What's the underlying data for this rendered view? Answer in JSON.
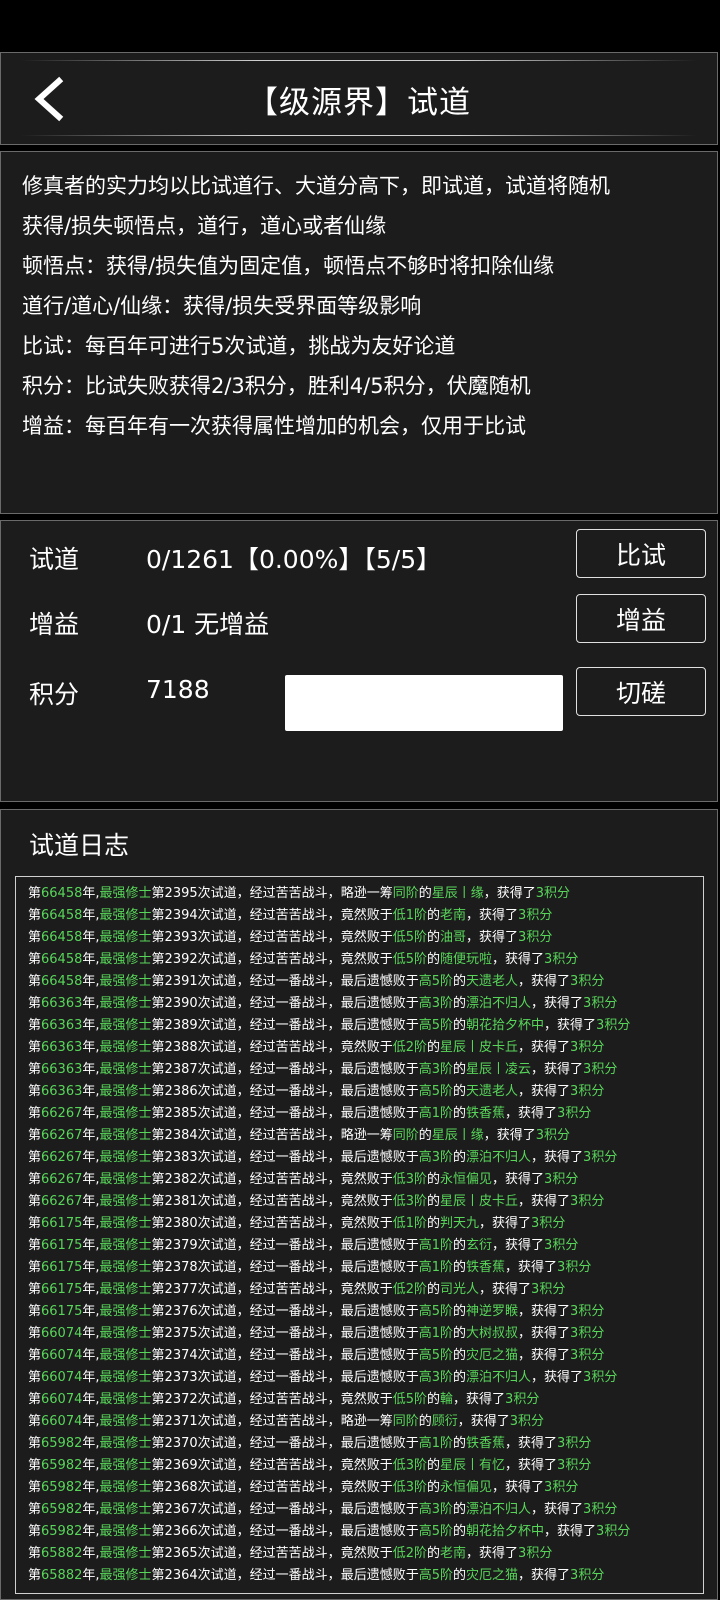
{
  "header": {
    "title": "【级源界】试道"
  },
  "rules": [
    "修真者的实力均以比试道行、大道分高下，即试道，试道将随机",
    "获得/损失顿悟点，道行，道心或者仙缘",
    "顿悟点：获得/损失值为固定值，顿悟点不够时将扣除仙缘",
    "道行/道心/仙缘：获得/损失受界面等级影响",
    "比试：每百年可进行5次试道，挑战为友好论道",
    "积分：比试失败获得2/3积分，胜利4/5积分，伏魔随机",
    "增益：每百年有一次获得属性增加的机会，仅用于比试"
  ],
  "stats": {
    "trial_label": "试道",
    "trial_value": "0/1261【0.00%】【5/5】",
    "trial_button": "比试",
    "buff_label": "增益",
    "buff_value": "0/1 无增益",
    "buff_button": "增益",
    "score_label": "积分",
    "score_value": "7188",
    "score_input_value": "",
    "spar_button": "切磋"
  },
  "log": {
    "title": "试道日志",
    "lines": [
      {
        "year": "66458",
        "n": "2395",
        "fight": "经过苦苦战斗",
        "res": "略逊一筹",
        "lv": "同阶",
        "foe": "星辰丨缘",
        "pts": "3"
      },
      {
        "year": "66458",
        "n": "2394",
        "fight": "经过苦苦战斗",
        "res": "竟然败于",
        "lv": "低1阶",
        "foe": "老南",
        "pts": "3"
      },
      {
        "year": "66458",
        "n": "2393",
        "fight": "经过苦苦战斗",
        "res": "竟然败于",
        "lv": "低5阶",
        "foe": "油哥",
        "pts": "3"
      },
      {
        "year": "66458",
        "n": "2392",
        "fight": "经过苦苦战斗",
        "res": "竟然败于",
        "lv": "低5阶",
        "foe": "随便玩啦",
        "pts": "3"
      },
      {
        "year": "66458",
        "n": "2391",
        "fight": "经过一番战斗",
        "res": "最后遗憾败于",
        "lv": "高5阶",
        "foe": "天遗老人",
        "pts": "3"
      },
      {
        "year": "66363",
        "n": "2390",
        "fight": "经过一番战斗",
        "res": "最后遗憾败于",
        "lv": "高3阶",
        "foe": "漂泊不归人",
        "pts": "3"
      },
      {
        "year": "66363",
        "n": "2389",
        "fight": "经过一番战斗",
        "res": "最后遗憾败于",
        "lv": "高5阶",
        "foe": "朝花拾夕杯中",
        "pts": "3"
      },
      {
        "year": "66363",
        "n": "2388",
        "fight": "经过苦苦战斗",
        "res": "竟然败于",
        "lv": "低2阶",
        "foe": "星辰丨皮卡丘",
        "pts": "3"
      },
      {
        "year": "66363",
        "n": "2387",
        "fight": "经过一番战斗",
        "res": "最后遗憾败于",
        "lv": "高3阶",
        "foe": "星辰丨凌云",
        "pts": "3"
      },
      {
        "year": "66363",
        "n": "2386",
        "fight": "经过一番战斗",
        "res": "最后遗憾败于",
        "lv": "高5阶",
        "foe": "天遗老人",
        "pts": "3"
      },
      {
        "year": "66267",
        "n": "2385",
        "fight": "经过一番战斗",
        "res": "最后遗憾败于",
        "lv": "高1阶",
        "foe": "铁香蕉",
        "pts": "3"
      },
      {
        "year": "66267",
        "n": "2384",
        "fight": "经过苦苦战斗",
        "res": "略逊一筹",
        "lv": "同阶",
        "foe": "星辰丨缘",
        "pts": "3"
      },
      {
        "year": "66267",
        "n": "2383",
        "fight": "经过一番战斗",
        "res": "最后遗憾败于",
        "lv": "高3阶",
        "foe": "漂泊不归人",
        "pts": "3"
      },
      {
        "year": "66267",
        "n": "2382",
        "fight": "经过苦苦战斗",
        "res": "竟然败于",
        "lv": "低3阶",
        "foe": "永恒偏见",
        "pts": "3"
      },
      {
        "year": "66267",
        "n": "2381",
        "fight": "经过苦苦战斗",
        "res": "竟然败于",
        "lv": "低3阶",
        "foe": "星辰丨皮卡丘",
        "pts": "3"
      },
      {
        "year": "66175",
        "n": "2380",
        "fight": "经过苦苦战斗",
        "res": "竟然败于",
        "lv": "低1阶",
        "foe": "判天九",
        "pts": "3"
      },
      {
        "year": "66175",
        "n": "2379",
        "fight": "经过一番战斗",
        "res": "最后遗憾败于",
        "lv": "高1阶",
        "foe": "玄衍",
        "pts": "3"
      },
      {
        "year": "66175",
        "n": "2378",
        "fight": "经过一番战斗",
        "res": "最后遗憾败于",
        "lv": "高1阶",
        "foe": "铁香蕉",
        "pts": "3"
      },
      {
        "year": "66175",
        "n": "2377",
        "fight": "经过苦苦战斗",
        "res": "竟然败于",
        "lv": "低2阶",
        "foe": "司光人",
        "pts": "3"
      },
      {
        "year": "66175",
        "n": "2376",
        "fight": "经过一番战斗",
        "res": "最后遗憾败于",
        "lv": "高5阶",
        "foe": "神逆罗睺",
        "pts": "3"
      },
      {
        "year": "66074",
        "n": "2375",
        "fight": "经过一番战斗",
        "res": "最后遗憾败于",
        "lv": "高1阶",
        "foe": "大树叔叔",
        "pts": "3"
      },
      {
        "year": "66074",
        "n": "2374",
        "fight": "经过一番战斗",
        "res": "最后遗憾败于",
        "lv": "高5阶",
        "foe": "灾厄之猫",
        "pts": "3"
      },
      {
        "year": "66074",
        "n": "2373",
        "fight": "经过一番战斗",
        "res": "最后遗憾败于",
        "lv": "高3阶",
        "foe": "漂泊不归人",
        "pts": "3"
      },
      {
        "year": "66074",
        "n": "2372",
        "fight": "经过苦苦战斗",
        "res": "竟然败于",
        "lv": "低5阶",
        "foe": "輪",
        "pts": "3"
      },
      {
        "year": "66074",
        "n": "2371",
        "fight": "经过苦苦战斗",
        "res": "略逊一筹",
        "lv": "同阶",
        "foe": "顾衍",
        "pts": "3"
      },
      {
        "year": "65982",
        "n": "2370",
        "fight": "经过一番战斗",
        "res": "最后遗憾败于",
        "lv": "高1阶",
        "foe": "铁香蕉",
        "pts": "3"
      },
      {
        "year": "65982",
        "n": "2369",
        "fight": "经过苦苦战斗",
        "res": "竟然败于",
        "lv": "低3阶",
        "foe": "星辰丨有忆",
        "pts": "3"
      },
      {
        "year": "65982",
        "n": "2368",
        "fight": "经过苦苦战斗",
        "res": "竟然败于",
        "lv": "低3阶",
        "foe": "永恒偏见",
        "pts": "3"
      },
      {
        "year": "65982",
        "n": "2367",
        "fight": "经过一番战斗",
        "res": "最后遗憾败于",
        "lv": "高3阶",
        "foe": "漂泊不归人",
        "pts": "3"
      },
      {
        "year": "65982",
        "n": "2366",
        "fight": "经过一番战斗",
        "res": "最后遗憾败于",
        "lv": "高5阶",
        "foe": "朝花拾夕杯中",
        "pts": "3"
      },
      {
        "year": "65882",
        "n": "2365",
        "fight": "经过苦苦战斗",
        "res": "竟然败于",
        "lv": "低2阶",
        "foe": "老南",
        "pts": "3"
      },
      {
        "year": "65882",
        "n": "2364",
        "fight": "经过一番战斗",
        "res": "最后遗憾败于",
        "lv": "高5阶",
        "foe": "灾厄之猫",
        "pts": "3"
      }
    ]
  }
}
